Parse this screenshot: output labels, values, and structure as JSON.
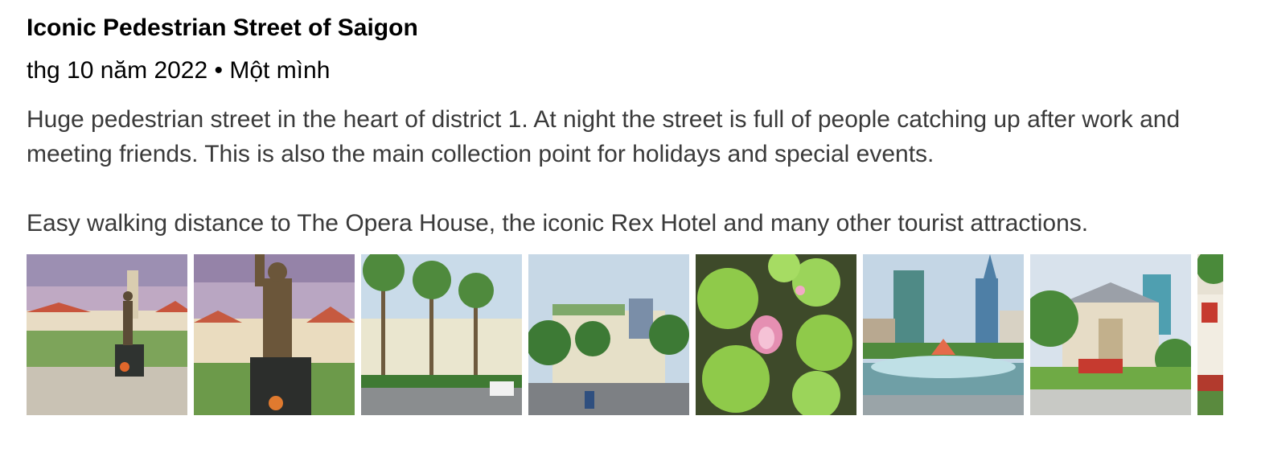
{
  "review": {
    "title": "Iconic Pedestrian Street of Saigon",
    "meta": "thg 10 năm 2022 • Một mình",
    "paragraphs": [
      "Huge pedestrian street in the heart of district 1. At night the street is full of people catching up after work and meeting friends. This is also the main collection point for holidays and special events.",
      "Easy walking distance to The Opera House, the iconic Rex Hotel and many other tourist attractions."
    ]
  },
  "photos": [
    {
      "subject": "statue-city-hall"
    },
    {
      "subject": "statue-closeup"
    },
    {
      "subject": "palm-street"
    },
    {
      "subject": "street-buildings"
    },
    {
      "subject": "lotus-pond"
    },
    {
      "subject": "fountain-skyline"
    },
    {
      "subject": "opera-house"
    },
    {
      "subject": "partial-photo"
    }
  ],
  "colors": {
    "title": "#000000",
    "body": "#3a3a3a"
  }
}
